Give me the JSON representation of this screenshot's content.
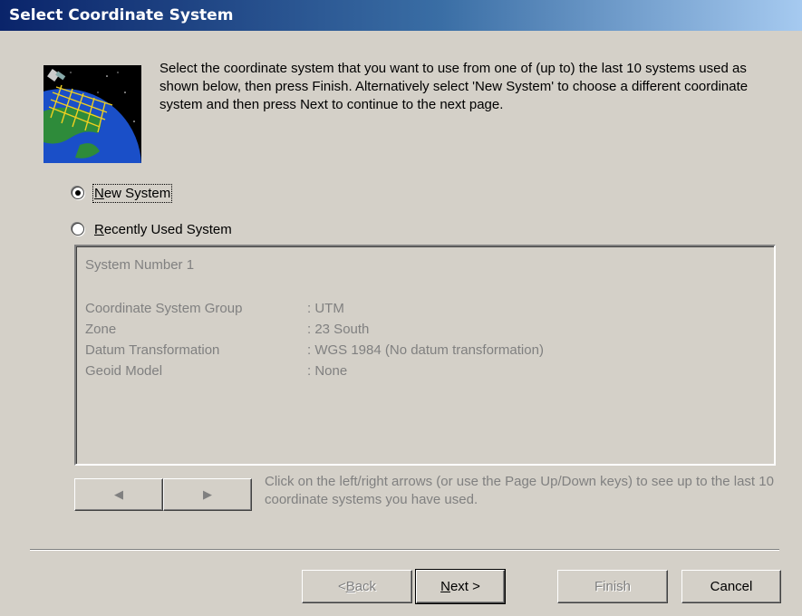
{
  "window": {
    "title": "Select Coordinate System"
  },
  "intro_text": "Select the coordinate system that you want to use from one of (up to) the last 10 systems used as shown below, then press Finish. Alternatively select 'New System' to choose a different coordinate system and then press Next to continue to the next page.",
  "options": {
    "new_system": {
      "label_hotkey": "N",
      "label_rest": "ew System",
      "checked": true
    },
    "recent": {
      "label_hotkey": "R",
      "label_rest": "ecently Used System",
      "checked": false
    }
  },
  "panel": {
    "system_number": "System Number 1",
    "rows": [
      {
        "key": "Coordinate System Group",
        "value": ": UTM"
      },
      {
        "key": "Zone",
        "value": ": 23 South"
      },
      {
        "key": "Datum Transformation",
        "value": ": WGS 1984  (No datum transformation)"
      },
      {
        "key": "Geoid Model",
        "value": ": None"
      }
    ]
  },
  "hint_text": "Click on the left/right arrows (or use the Page Up/Down keys) to see up to the last 10 coordinate systems you have used.",
  "nav": {
    "prev_icon": "◀",
    "next_icon": "▶"
  },
  "buttons": {
    "back_pre": "< ",
    "back_hotkey": "B",
    "back_rest": "ack",
    "next_hotkey": "N",
    "next_rest": "ext >",
    "finish": "Finish",
    "cancel": "Cancel"
  },
  "icons": {
    "globe": "globe-grid-icon",
    "satellite": "satellite-icon",
    "prev": "triangle-left-icon",
    "next": "triangle-right-icon"
  },
  "colors": {
    "title_gradient_start": "#0a246a",
    "title_gradient_end": "#a6caf0",
    "dialog_bg": "#d4d0c8",
    "disabled_text": "#808080"
  }
}
